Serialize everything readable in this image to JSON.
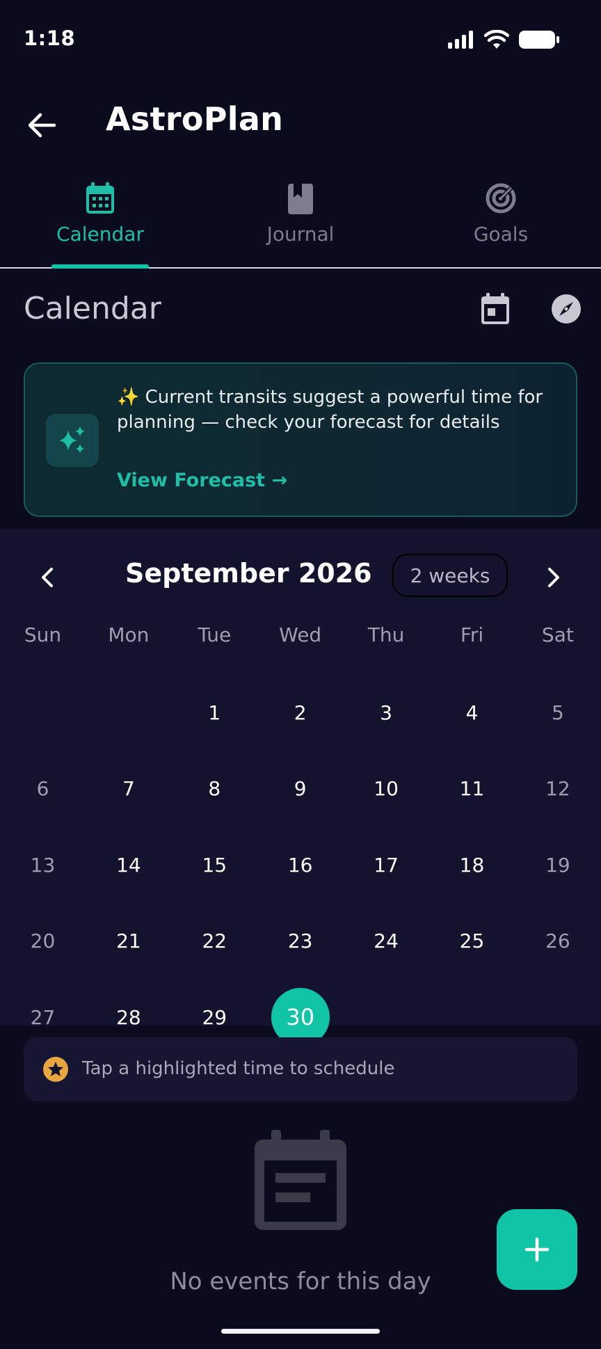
{
  "status": {
    "time": "1:18"
  },
  "app": {
    "title": "AstroPlan"
  },
  "tabs": [
    {
      "label": "Calendar",
      "icon": "calendar-grid-icon",
      "active": true
    },
    {
      "label": "Journal",
      "icon": "book-icon",
      "active": false
    },
    {
      "label": "Goals",
      "icon": "target-icon",
      "active": false
    }
  ],
  "section": {
    "title": "Calendar"
  },
  "insight": {
    "text": "✨ Current transits suggest a powerful time for planning — check your forecast for details",
    "link": "View Forecast →",
    "icon": "sparkles-icon"
  },
  "calendar": {
    "month_title": "September 2026",
    "range_label": "2 weeks",
    "weekdays": [
      "Sun",
      "Mon",
      "Tue",
      "Wed",
      "Thu",
      "Fri",
      "Sat"
    ],
    "first_weekday_index": 2,
    "days_in_month": 30,
    "selected_day": 30
  },
  "hint": {
    "text": "Tap a highlighted time to schedule",
    "icon": "star-icon"
  },
  "empty": {
    "text": "No events for this day",
    "icon": "event-note-icon"
  },
  "fab": {
    "icon": "plus-icon"
  },
  "colors": {
    "accent": "#12c4a6",
    "background": "#0b0b1e",
    "panel": "#13132e",
    "star": "#e8a640"
  }
}
